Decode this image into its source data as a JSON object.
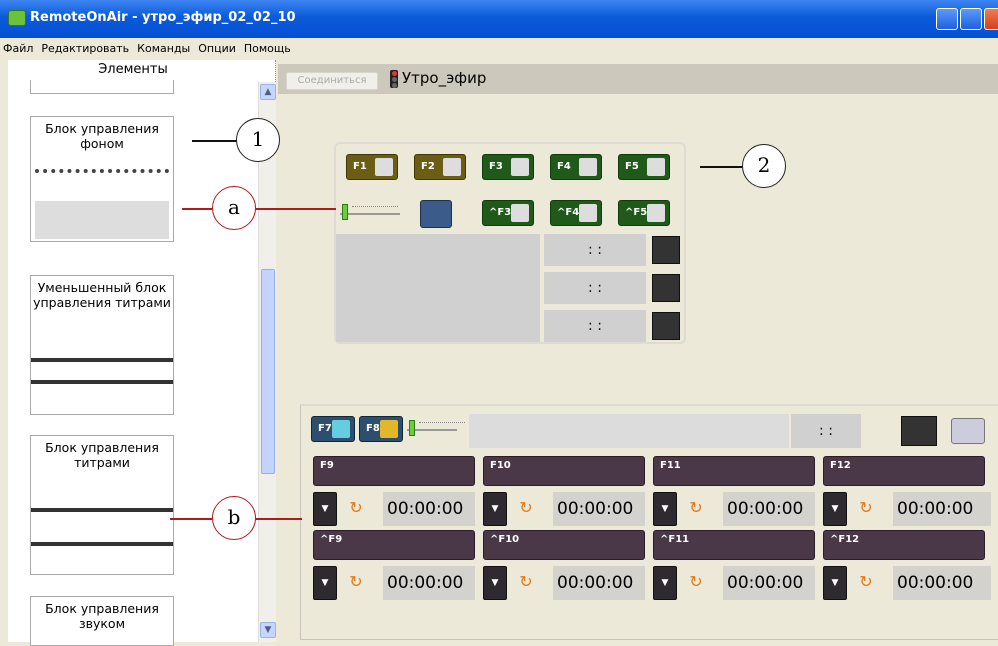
{
  "window": {
    "title": "RemoteOnAir - утро_эфир_02_02_10"
  },
  "menu": [
    "Файл",
    "Редактировать",
    "Команды",
    "Опции",
    "Помощь"
  ],
  "left_panel": {
    "header": "Элементы",
    "cards": [
      {
        "title": "Блок управления фоном"
      },
      {
        "title": "Уменьшенный блок управления титрами"
      },
      {
        "title": "Блок управления титрами"
      },
      {
        "title": "Блок управления звуком"
      }
    ]
  },
  "toolbar": {
    "connect_label": "Соединиться",
    "playlist_title": "Утро_эфир"
  },
  "block1": {
    "buttons_row1": [
      "F1",
      "F2",
      "F3",
      "F4",
      "F5"
    ],
    "buttons_row2": [
      "^F3",
      "^F4",
      "^F5"
    ],
    "time_cells": [
      ": :",
      ": :",
      ": :"
    ]
  },
  "block2": {
    "buttons": [
      "F7",
      "F8"
    ],
    "time_display": ": :",
    "channels": [
      "F9",
      "F10",
      "F11",
      "F12",
      "^F9",
      "^F10",
      "^F11",
      "^F12"
    ],
    "timers": [
      "00:00:00",
      "00:00:00",
      "00:00:00",
      "00:00:00",
      "00:00:00",
      "00:00:00",
      "00:00:00",
      "00:00:00"
    ]
  },
  "callouts": [
    "1",
    "2",
    "a",
    "b"
  ]
}
